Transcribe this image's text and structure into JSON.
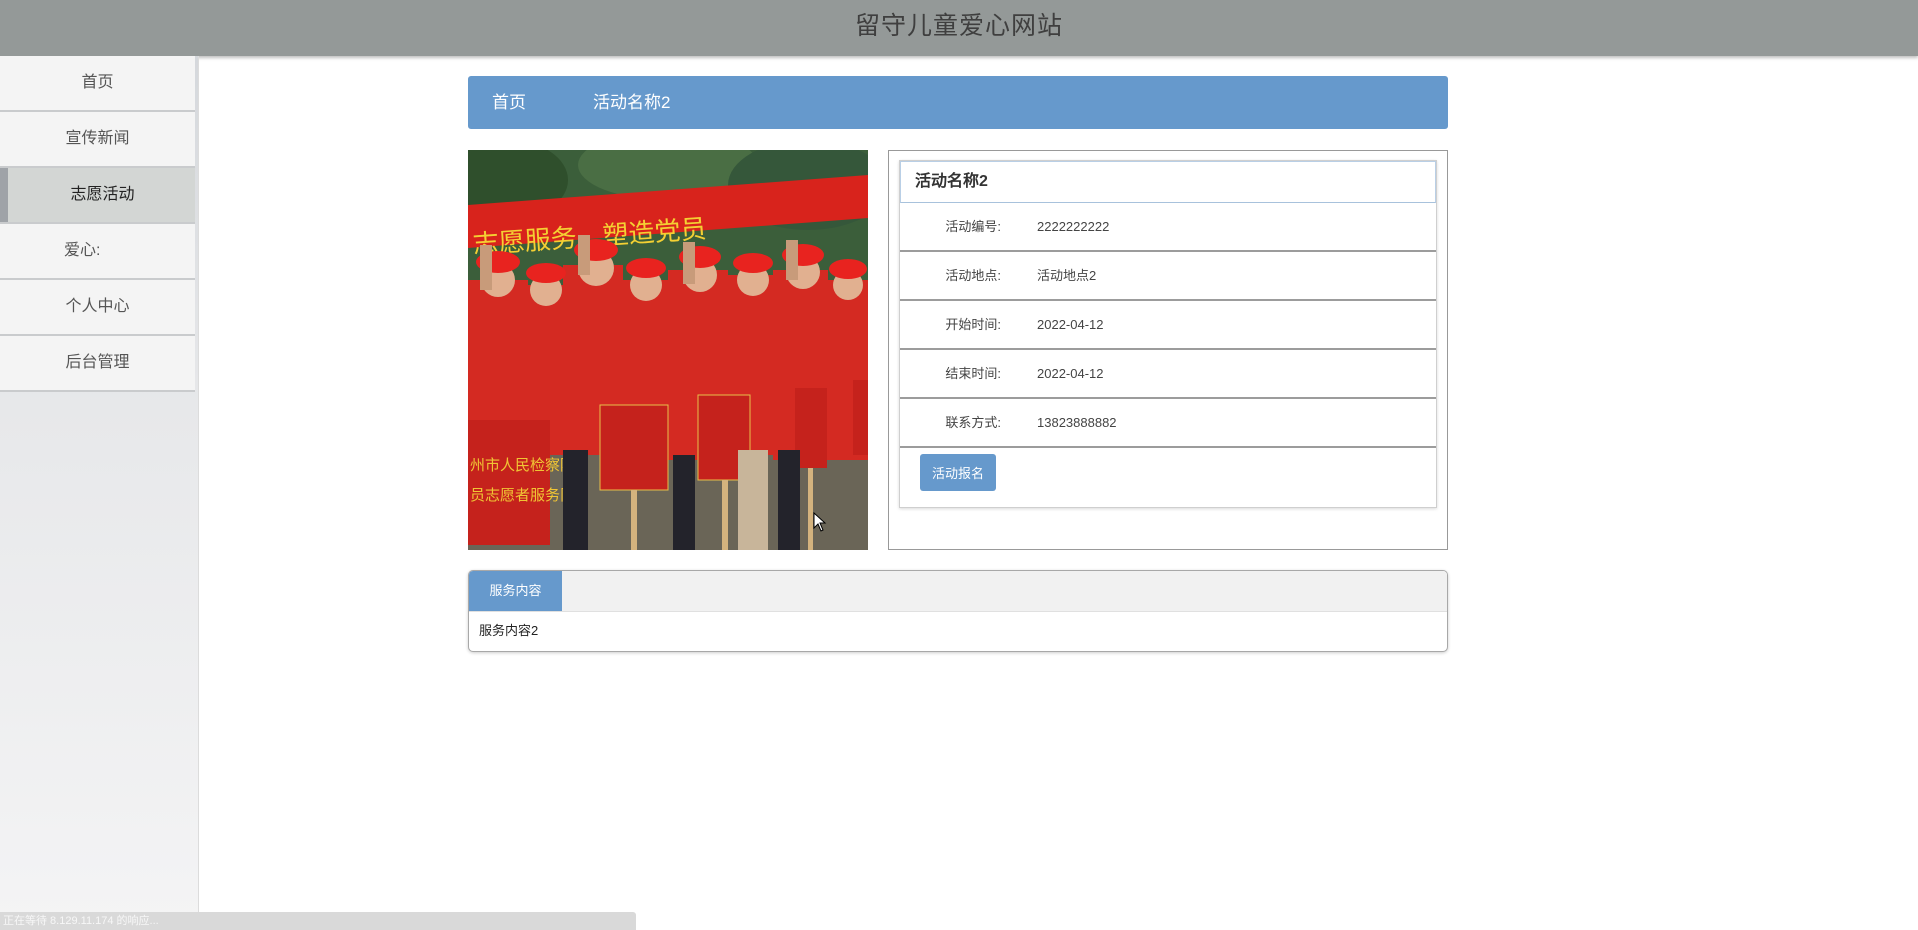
{
  "header": {
    "title": "留守儿童爱心网站"
  },
  "sidebar": {
    "items": [
      {
        "label": "首页"
      },
      {
        "label": "宣传新闻"
      },
      {
        "label": "志愿活动",
        "active": true
      },
      {
        "label": "爱心:"
      },
      {
        "label": "个人中心"
      },
      {
        "label": "后台管理"
      }
    ]
  },
  "breadcrumb": {
    "home": "首页",
    "current": "活动名称2"
  },
  "activity": {
    "title": "活动名称2",
    "fields": [
      {
        "label": "活动编号:",
        "value": "2222222222"
      },
      {
        "label": "活动地点:",
        "value": "活动地点2"
      },
      {
        "label": "开始时间:",
        "value": "2022-04-12"
      },
      {
        "label": "结束时间:",
        "value": "2022-04-12"
      },
      {
        "label": "联系方式:",
        "value": "13823888882"
      }
    ],
    "signup_label": "活动报名"
  },
  "photo": {
    "banner_text": "志愿服务，塑造党员",
    "sign_texts": [
      "州市人民检察院",
      "员志愿者服务队"
    ]
  },
  "tabs": {
    "active_label": "服务内容",
    "content": "服务内容2"
  },
  "status": {
    "text": "正在等待 8.129.11.174 的响应..."
  },
  "colors": {
    "accent": "#6699cc",
    "header_bg": "#949998"
  }
}
